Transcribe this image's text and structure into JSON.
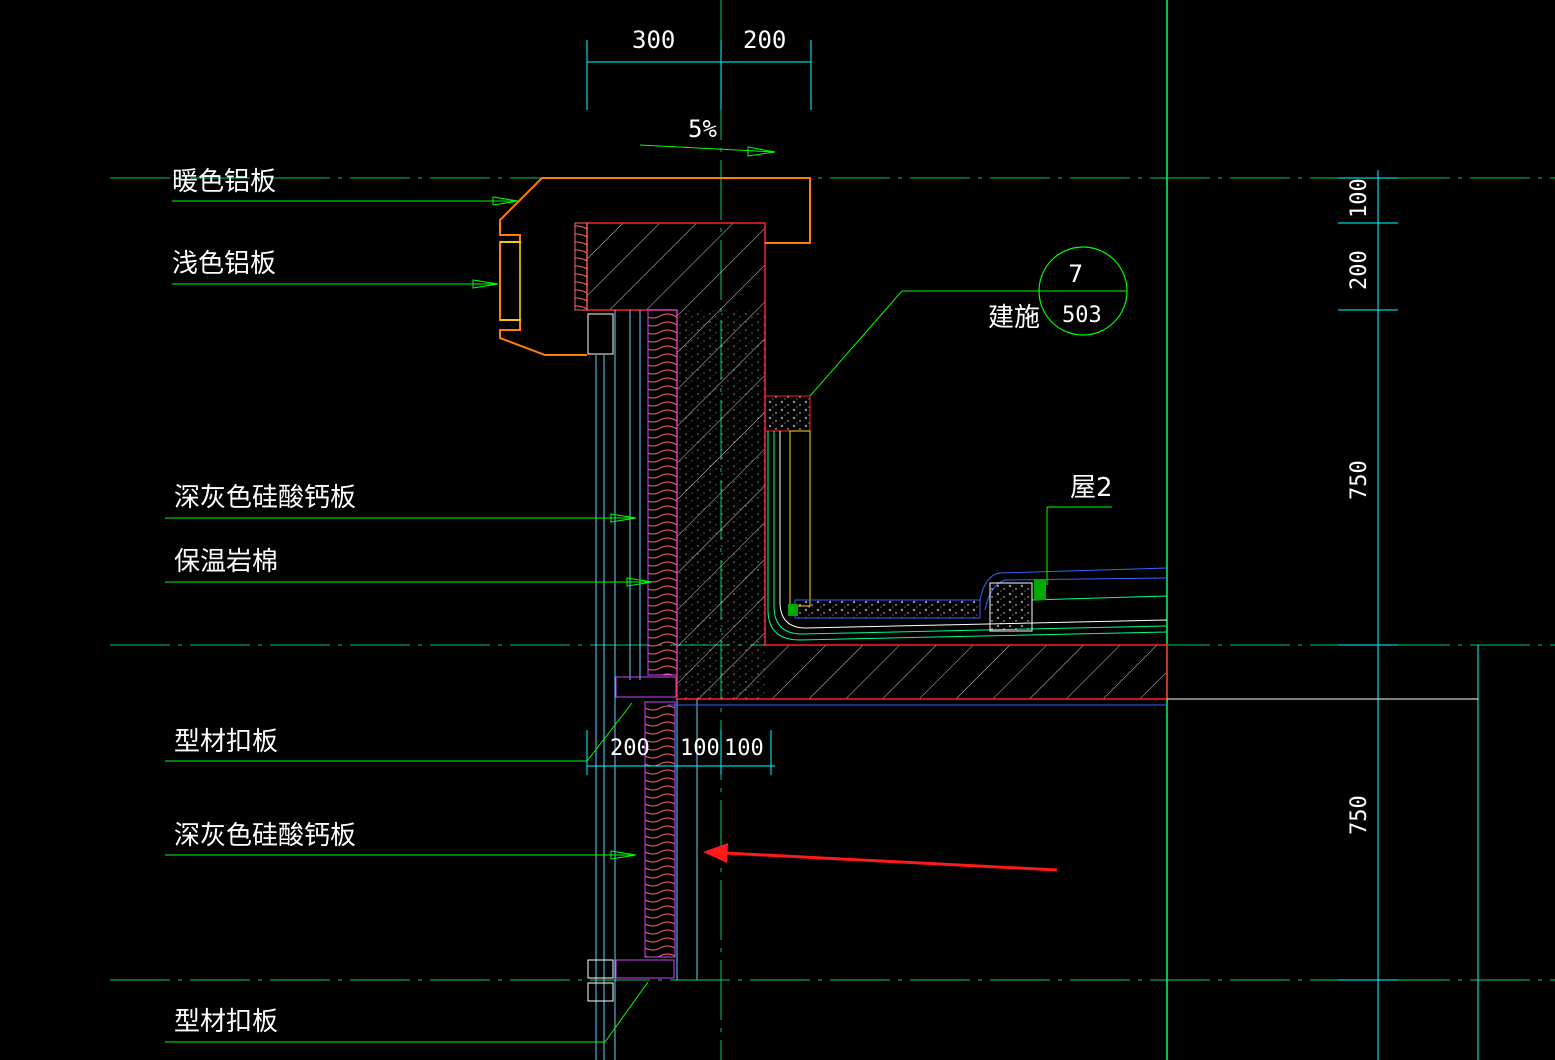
{
  "labels": {
    "warm_aluminum": "暖色铝板",
    "light_aluminum": "浅色铝板",
    "dark_gray_board_1": "深灰色硅酸钙板",
    "insulation_rock_wool": "保温岩棉",
    "profile_cover_1": "型材扣板",
    "dark_gray_board_2": "深灰色硅酸钙板",
    "profile_cover_2": "型材扣板"
  },
  "dimensions": {
    "top_300": "300",
    "top_200": "200",
    "slope": "5%",
    "right_100": "100",
    "right_200": "200",
    "right_750_upper": "750",
    "right_750_lower": "750",
    "bottom_200": "200",
    "bottom_100_a": "100",
    "bottom_100_b": "100"
  },
  "detail_callout": {
    "number": "7",
    "sheet": "503",
    "prefix": "建施"
  },
  "roof_tag": "屋2",
  "colors": {
    "background": "#000000",
    "leader_green": "#00ff00",
    "dim_green": "#00ffff",
    "structure_red": "#ff2020",
    "aluminum_orange": "#ff8000",
    "insulation_pink": "#ff6666",
    "board_magenta": "#cc44ff",
    "frame_cyan": "#66ccff",
    "annotation_arrow": "#ff1a1a"
  }
}
